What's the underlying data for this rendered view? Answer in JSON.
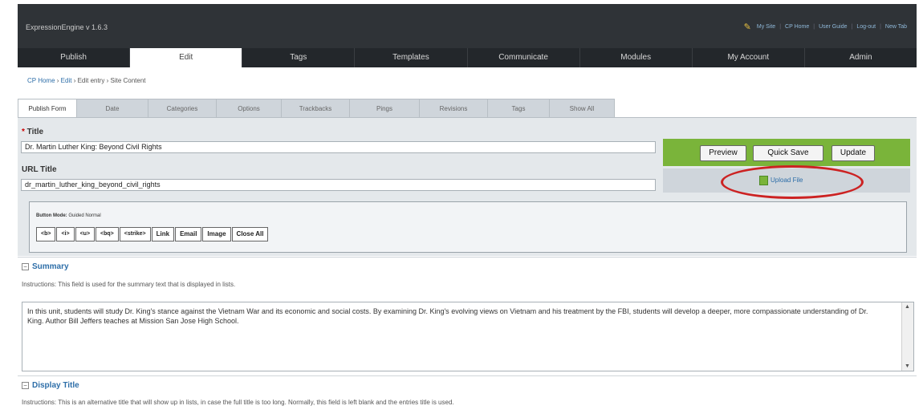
{
  "app": {
    "title": "ExpressionEngine v 1.6.3"
  },
  "toplinks": [
    "My Site",
    "CP Home",
    "User Guide",
    "Log-out",
    "New Tab"
  ],
  "nav": {
    "tabs": [
      "Publish",
      "Edit",
      "Tags",
      "Templates",
      "Communicate",
      "Modules",
      "My Account",
      "Admin"
    ]
  },
  "breadcrumb": [
    "CP Home",
    "Edit",
    "Edit entry",
    "Site Content"
  ],
  "subtabs": [
    "Publish Form",
    "Date",
    "Categories",
    "Options",
    "Trackbacks",
    "Pings",
    "Revisions",
    "Tags",
    "Show All"
  ],
  "form": {
    "title_label": "Title",
    "title_value": "Dr. Martin Luther King: Beyond Civil Rights",
    "url_label": "URL Title",
    "url_value": "dr_martin_luther_king_beyond_civil_rights"
  },
  "actions": {
    "preview": "Preview",
    "quick_save": "Quick Save",
    "update": "Update",
    "upload": "Upload File"
  },
  "toolbar": {
    "button_mode_label": "Button Mode:",
    "modes": "Guided Normal",
    "buttons": [
      "<b>",
      "<i>",
      "<u>",
      "<bq>",
      "<strike>",
      "Link",
      "Email",
      "Image",
      "Close All"
    ]
  },
  "summary": {
    "title": "Summary",
    "instructions": "Instructions: This field is used for the summary text that is displayed in lists.",
    "text": "In this unit, students will study Dr. King's stance against the Vietnam War and its economic and social costs. By examining Dr. King's evolving views on Vietnam and his treatment by the FBI, students will develop a deeper, more compassionate understanding of Dr. King. Author Bill Jeffers teaches at Mission San Jose High School."
  },
  "display_title": {
    "title": "Display Title",
    "instructions": "Instructions: This is an alternative title that will show up in lists, in case the full title is too long. Normally, this field is left blank and the entries title is used."
  },
  "colors": {
    "accent_green": "#7ab43a",
    "link_blue": "#2d6ea8",
    "highlight_red": "#cc2222",
    "dark_nav": "#23272b"
  }
}
